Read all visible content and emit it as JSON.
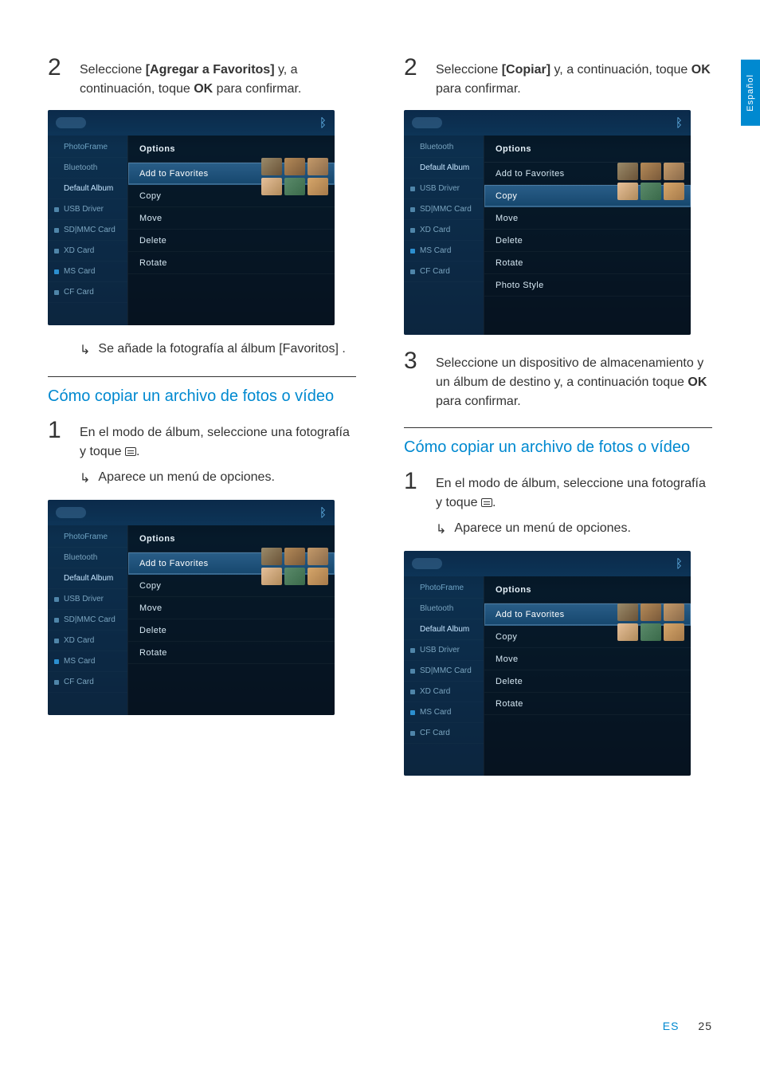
{
  "lang_tab": "Español",
  "footer": {
    "lang": "ES",
    "page": "25"
  },
  "left": {
    "step2": {
      "num": "2",
      "pre": "Seleccione ",
      "opt": "[Agregar a Favoritos]",
      "mid": " y, a continuación, toque ",
      "ok": "OK",
      "post": " para confirmar."
    },
    "result1_pre": "Se añade la fotografía al álbum ",
    "result1_opt": "[Favoritos]",
    "result1_post": " .",
    "heading1": "Cómo copiar un archivo de fotos o vídeo",
    "step1": {
      "num": "1",
      "text_a": "En el modo de álbum, seleccione una fotografía y toque ",
      "text_b": "."
    },
    "result2": "Aparece un menú de opciones."
  },
  "right": {
    "step2": {
      "num": "2",
      "pre": "Seleccione ",
      "opt": "[Copiar]",
      "mid": " y, a continuación, toque ",
      "ok": "OK",
      "post": " para confirmar."
    },
    "step3": {
      "num": "3",
      "text_a": "Seleccione un dispositivo de almacenamiento y un álbum de destino y, a continuación toque ",
      "ok": "OK",
      "text_b": " para confirmar."
    },
    "heading1": "Cómo copiar un archivo de fotos o vídeo",
    "step1": {
      "num": "1",
      "text_a": "En el modo de álbum, seleccione una fotografía y toque ",
      "text_b": "."
    },
    "result1": "Aparece un menú de opciones."
  },
  "device_common": {
    "pane_title": "Options",
    "sidebar": [
      "PhotoFrame",
      "Bluetooth",
      "Default Album",
      "USB Driver",
      "SD|MMC Card",
      "XD Card",
      "MS Card",
      "CF Card"
    ]
  },
  "shot_A": {
    "highlight_index": 0,
    "options": [
      "Add to Favorites",
      "Copy",
      "Move",
      "Delete",
      "Rotate"
    ]
  },
  "shot_B": {
    "highlight_index": 1,
    "options": [
      "Add to Favorites",
      "Copy",
      "Move",
      "Delete",
      "Rotate",
      "Photo Style"
    ]
  }
}
